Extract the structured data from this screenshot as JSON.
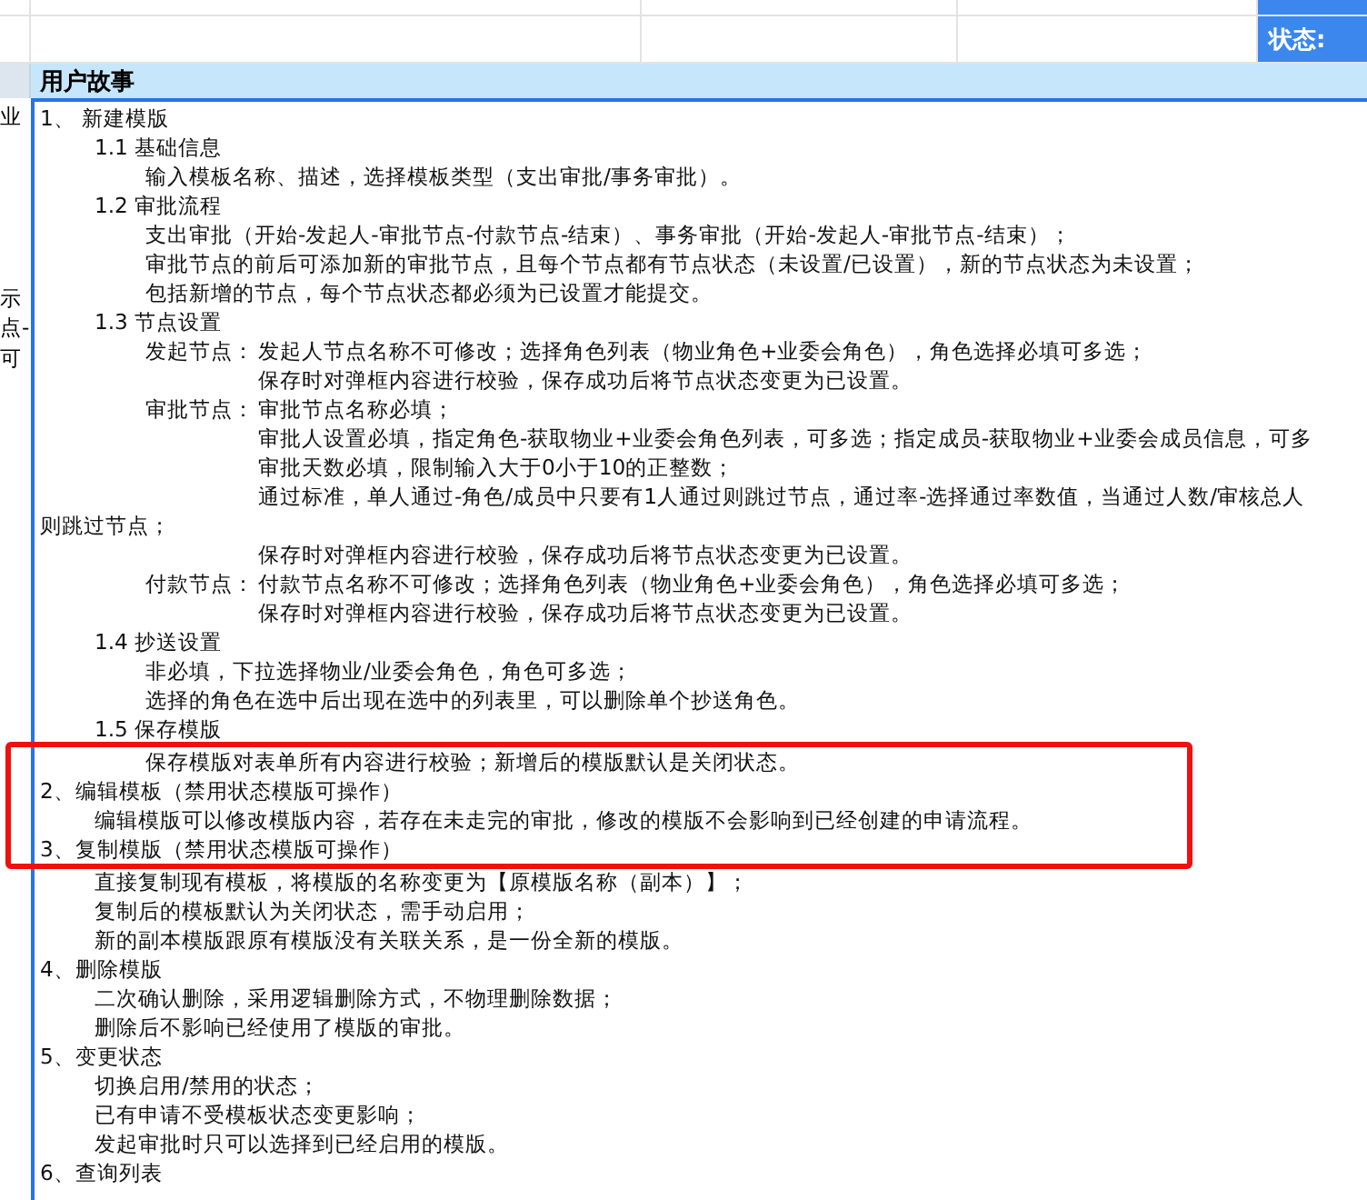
{
  "top_rows": [
    {},
    {
      "status_label": "状态:"
    }
  ],
  "header": {
    "title": "用户故事"
  },
  "lines": [
    {
      "kind": "section",
      "text": "1、 新建模版",
      "side_text": "业",
      "highlighted": false
    },
    {
      "kind": "sub",
      "text": "1.1 基础信息",
      "highlighted": false
    },
    {
      "kind": "body",
      "text": "输入模板名称、描述，选择模板类型（支出审批/事务审批）。",
      "highlighted": false
    },
    {
      "kind": "sub",
      "text": "1.2 审批流程",
      "highlighted": false
    },
    {
      "kind": "body",
      "text": "支出审批（开始-发起人-审批节点-付款节点-结束）、事务审批（开始-发起人-审批节点-结束）；",
      "highlighted": false
    },
    {
      "kind": "body",
      "text": "审批节点的前后可添加新的审批节点，且每个节点都有节点状态（未设置/已设置），新的节点状态为未设置；",
      "highlighted": false
    },
    {
      "kind": "body",
      "text": "包括新增的节点，每个节点状态都必须为已设置才能提交。",
      "side_text": "示",
      "highlighted": false
    },
    {
      "kind": "sub",
      "text": "1.3 节点设置",
      "side_text": "点-",
      "highlighted": false
    },
    {
      "kind": "node",
      "label": "发起节点：",
      "text": "发起人节点名称不可修改；选择角色列表（物业角色+业委会角色），角色选择必填可多选；",
      "side_text": "可",
      "highlighted": false
    },
    {
      "kind": "detail",
      "text": "保存时对弹框内容进行校验，保存成功后将节点状态变更为已设置。",
      "highlighted": false
    },
    {
      "kind": "node",
      "label": "审批节点：",
      "text": "审批节点名称必填；",
      "highlighted": false
    },
    {
      "kind": "detail",
      "text": "审批人设置必填，指定角色-获取物业+业委会角色列表，可多选；指定成员-获取物业+业委会成员信息，可多",
      "highlighted": false
    },
    {
      "kind": "detail",
      "text": "审批天数必填，限制输入大于0小于10的正整数；",
      "highlighted": false
    },
    {
      "kind": "detail",
      "text": "通过标准，单人通过-角色/成员中只要有1人通过则跳过节点，通过率-选择通过率数值，当通过人数/审核总人",
      "highlighted": false
    },
    {
      "kind": "wrap",
      "text": "则跳过节点；",
      "highlighted": false
    },
    {
      "kind": "detail",
      "text": "保存时对弹框内容进行校验，保存成功后将节点状态变更为已设置。",
      "highlighted": false
    },
    {
      "kind": "node",
      "label": "付款节点：",
      "text": "付款节点名称不可修改；选择角色列表（物业角色+业委会角色），角色选择必填可多选；",
      "highlighted": false
    },
    {
      "kind": "detail",
      "text": "保存时对弹框内容进行校验，保存成功后将节点状态变更为已设置。",
      "highlighted": false
    },
    {
      "kind": "sub",
      "text": "1.4 抄送设置",
      "highlighted": false
    },
    {
      "kind": "body",
      "text": "非必填，下拉选择物业/业委会角色，角色可多选；",
      "highlighted": false
    },
    {
      "kind": "body",
      "text": "选择的角色在选中后出现在选中的列表里，可以删除单个抄送角色。",
      "highlighted": false
    },
    {
      "kind": "sub",
      "text": "1.5 保存模版",
      "highlighted": false
    },
    {
      "kind": "body",
      "text": "保存模版对表单所有内容进行校验；新增后的模版默认是关闭状态。",
      "highlighted": true
    },
    {
      "kind": "section",
      "text": "2、编辑模板（禁用状态模版可操作）",
      "highlighted": true
    },
    {
      "kind": "sub",
      "text": "编辑模版可以修改模版内容，若存在未走完的审批，修改的模版不会影响到已经创建的申请流程。",
      "highlighted": true
    },
    {
      "kind": "section",
      "text": "3、复制模版（禁用状态模版可操作）",
      "highlighted": true
    },
    {
      "kind": "sub",
      "text": "直接复制现有模板，将模版的名称变更为【原模版名称（副本）】；",
      "highlighted": false
    },
    {
      "kind": "sub",
      "text": "复制后的模板默认为关闭状态，需手动启用；",
      "highlighted": false
    },
    {
      "kind": "sub",
      "text": "新的副本模版跟原有模版没有关联关系，是一份全新的模版。",
      "highlighted": false
    },
    {
      "kind": "section",
      "text": "4、删除模版",
      "highlighted": false
    },
    {
      "kind": "sub",
      "text": "二次确认删除，采用逻辑删除方式，不物理删除数据；",
      "highlighted": false
    },
    {
      "kind": "sub",
      "text": "删除后不影响已经使用了模版的审批。",
      "highlighted": false
    },
    {
      "kind": "section",
      "text": "5、变更状态",
      "highlighted": false
    },
    {
      "kind": "sub",
      "text": "切换启用/禁用的状态；",
      "highlighted": false
    },
    {
      "kind": "sub",
      "text": "已有申请不受模板状态变更影响；",
      "highlighted": false
    },
    {
      "kind": "sub",
      "text": "发起审批时只可以选择到已经启用的模版。",
      "highlighted": false
    },
    {
      "kind": "section",
      "text": "6、查询列表",
      "highlighted": false
    }
  ]
}
